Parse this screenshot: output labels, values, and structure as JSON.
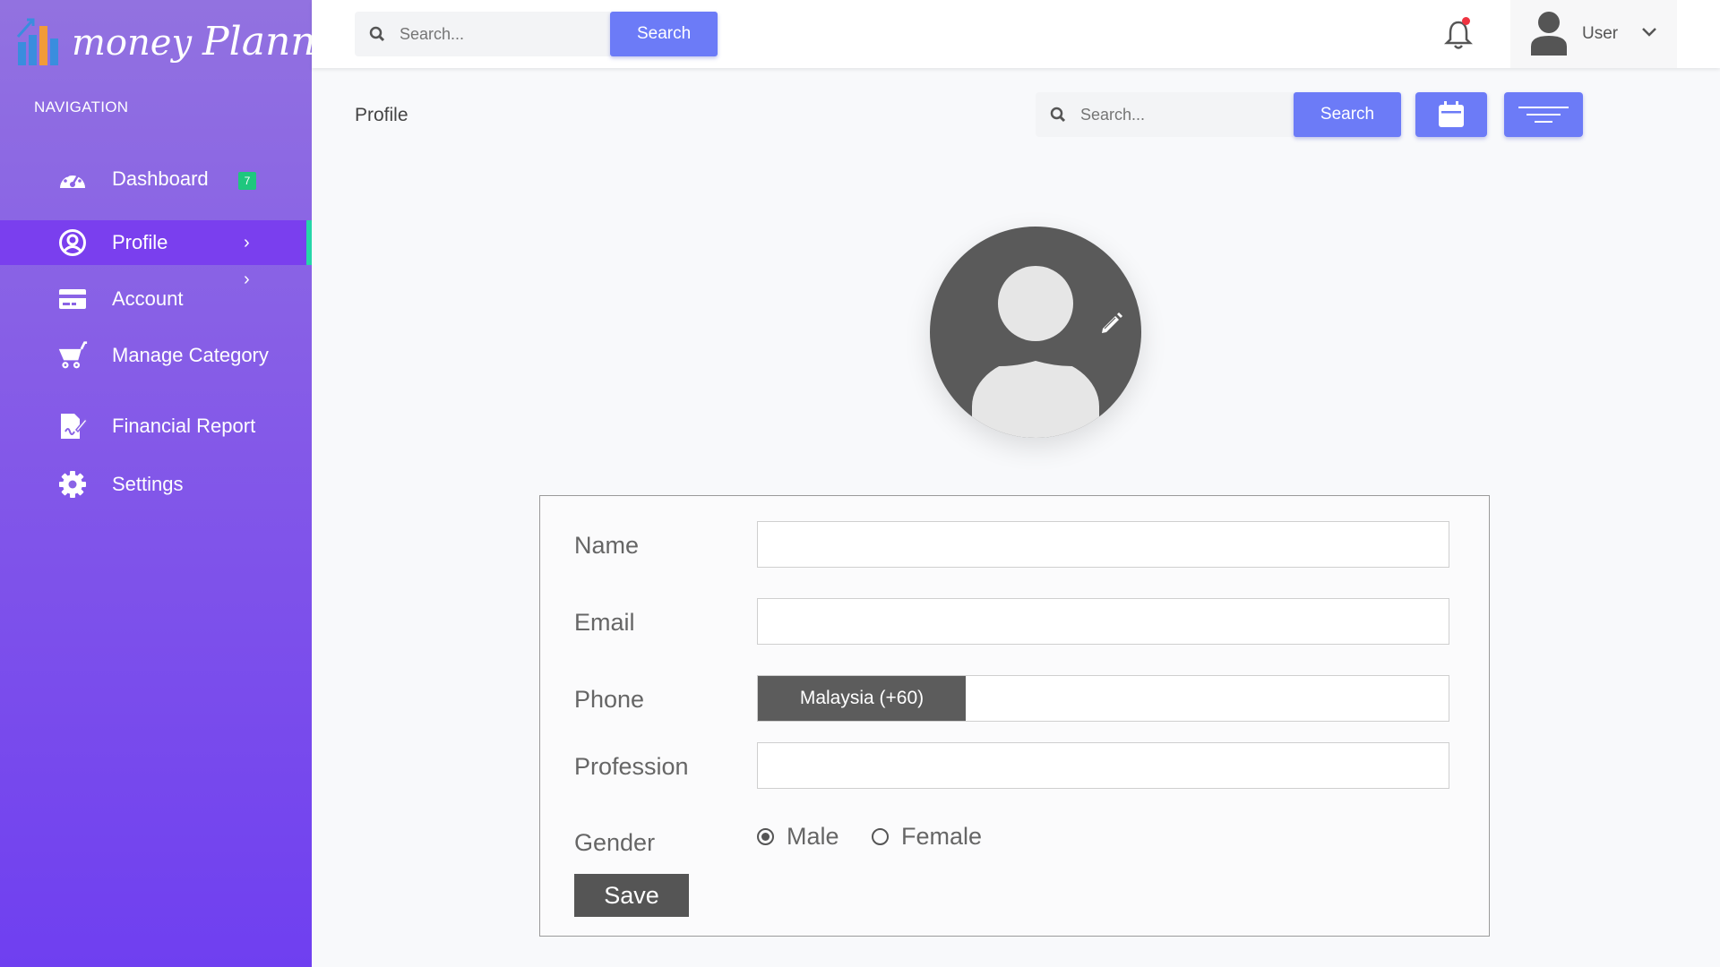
{
  "app": {
    "logo_word1": "money",
    "logo_word2": "Planner",
    "accent_color": "#6c7bf7",
    "sidebar_gradient": [
      "#9272e0",
      "#6f3ff0"
    ]
  },
  "sidebar": {
    "nav_title": "NAVIGATION",
    "items": [
      {
        "label": "Dashboard",
        "icon": "dashboard-gauge-icon",
        "badge": "7"
      },
      {
        "label": "Profile",
        "icon": "user-circle-icon",
        "active": true,
        "chevron": "›"
      },
      {
        "label": "Account",
        "icon": "credit-card-icon",
        "chevron": "›"
      },
      {
        "label": "Manage Category",
        "icon": "shopping-cart-icon"
      },
      {
        "label": "Financial Report",
        "icon": "file-signature-icon"
      },
      {
        "label": "Settings",
        "icon": "gear-icon"
      }
    ]
  },
  "header": {
    "search_placeholder": "Search...",
    "search_button": "Search",
    "notification_icon": "bell-icon",
    "has_unread": true,
    "user_name": "User"
  },
  "page": {
    "title": "Profile",
    "search_placeholder": "Search...",
    "search_button": "Search",
    "calendar_icon": "calendar-icon",
    "filter_icon": "filter-lines-icon"
  },
  "profile_form": {
    "name_label": "Name",
    "name_value": "",
    "email_label": "Email",
    "email_value": "",
    "phone_label": "Phone",
    "phone_country": "Malaysia (+60)",
    "phone_value": "",
    "profession_label": "Profession",
    "profession_value": "",
    "gender_label": "Gender",
    "gender_options": [
      "Male",
      "Female"
    ],
    "gender_selected": "Male",
    "save_button": "Save"
  }
}
